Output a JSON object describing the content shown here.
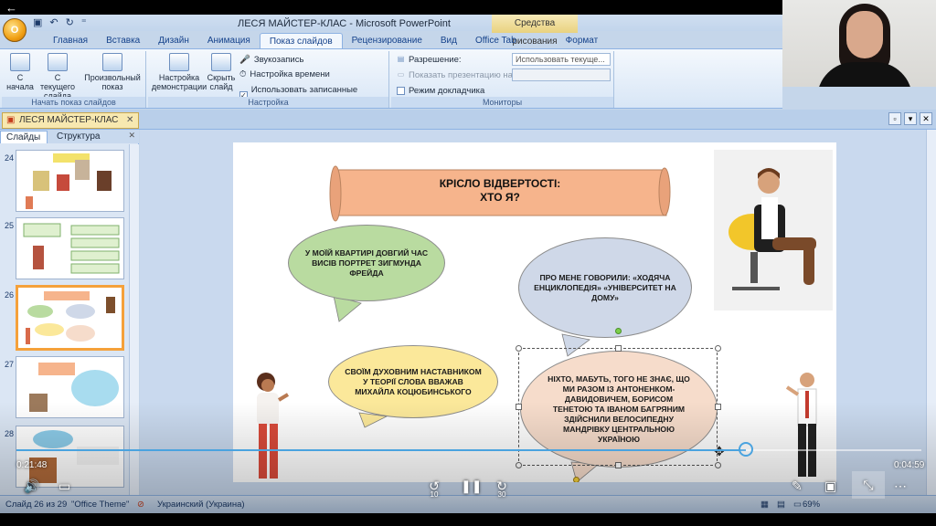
{
  "app": {
    "window_title": "ЛЕСЯ МАЙСТЕР-КЛАС - Microsoft PowerPoint",
    "contextual_tools": "Средства рисования",
    "orb_label": "O"
  },
  "ribbon": {
    "tabs": [
      {
        "label": "Главная"
      },
      {
        "label": "Вставка"
      },
      {
        "label": "Дизайн"
      },
      {
        "label": "Анимация"
      },
      {
        "label": "Показ слайдов",
        "active": true
      },
      {
        "label": "Рецензирование"
      },
      {
        "label": "Вид"
      },
      {
        "label": "Office Tab"
      },
      {
        "label": "Формат"
      }
    ],
    "groups": {
      "start_show": {
        "label": "Начать показ слайдов",
        "from_beginning": "С начала",
        "from_current": "С текущего слайда",
        "custom_show": "Произвольный показ"
      },
      "setup": {
        "label": "Настройка",
        "setup_show": "Настройка демонстрации",
        "hide_slide": "Скрыть слайд",
        "record_narration": "Звукозапись",
        "rehearse_timings": "Настройка времени",
        "use_timings": "Использовать записанные времена",
        "use_timings_checked": true
      },
      "monitors": {
        "label": "Мониторы",
        "resolution_label": "Разрешение:",
        "resolution_value": "Использовать текуще...",
        "show_on_label": "Показать презентацию на:",
        "show_on_value": "",
        "presenter_view": "Режим докладчика",
        "presenter_view_checked": false
      }
    }
  },
  "document_tab": {
    "label": "ЛЕСЯ МАЙСТЕР-КЛАС"
  },
  "left_pane": {
    "tabs": [
      {
        "label": "Слайды",
        "active": true
      },
      {
        "label": "Структура"
      }
    ],
    "thumbnails": [
      {
        "number": "24"
      },
      {
        "number": "25"
      },
      {
        "number": "26",
        "selected": true
      },
      {
        "number": "27"
      },
      {
        "number": "28"
      }
    ]
  },
  "slide": {
    "title_line1": "КРІСЛО ВІДВЕРТОСТІ:",
    "title_line2": "ХТО Я?",
    "bubbles": [
      {
        "text": "У МОЇЙ КВАРТИРІ ДОВГИЙ ЧАС ВИСІВ ПОРТРЕТ ЗИГМУНДА ФРЕЙДА",
        "color": "#b9dba0"
      },
      {
        "text": "ПРО МЕНЕ ГОВОРИЛИ: «ХОДЯЧА ЕНЦИКЛОПЕДІЯ» «УНІВЕРСИТЕТ НА ДОМУ»",
        "color": "#cfd8e8"
      },
      {
        "text": "СВОЇМ ДУХОВНИМ НАСТАВНИКОМ У ТЕОРІЇ СЛОВА ВВАЖАВ МИХАЙЛА КОЦЮБИНСЬКОГО",
        "color": "#fbe89a"
      },
      {
        "text": "НІХТО, МАБУТЬ, ТОГО НЕ ЗНАЄ, ЩО МИ РАЗОМ ІЗ АНТОНЕНКОМ-ДАВИДОВИЧЕМ, БОРИСОМ ТЕНЕТОЮ ТА ІВАНОМ БАГРЯНИМ ЗДІЙСНИЛИ ВЕЛОСИПЕДНУ МАНДРІВКУ ЦЕНТРАЛЬНОЮ УКРАЇНОЮ",
        "color": "#f6dccb"
      }
    ],
    "scroll_color": "#f6b48c"
  },
  "status_bar": {
    "slide_info": "Слайд 26 из 29",
    "theme": "\"Office Theme\"",
    "language": "Украинский (Украина)",
    "zoom": "69%"
  },
  "video": {
    "elapsed": "0:21:48",
    "remaining": "0:04:59",
    "progress_fraction": 0.806,
    "rewind_label": "10",
    "forward_label": "30"
  },
  "colors": {
    "ribbon_accent": "#15428b",
    "selected_thumb": "#f5a13a",
    "progress": "#4aa3df"
  }
}
